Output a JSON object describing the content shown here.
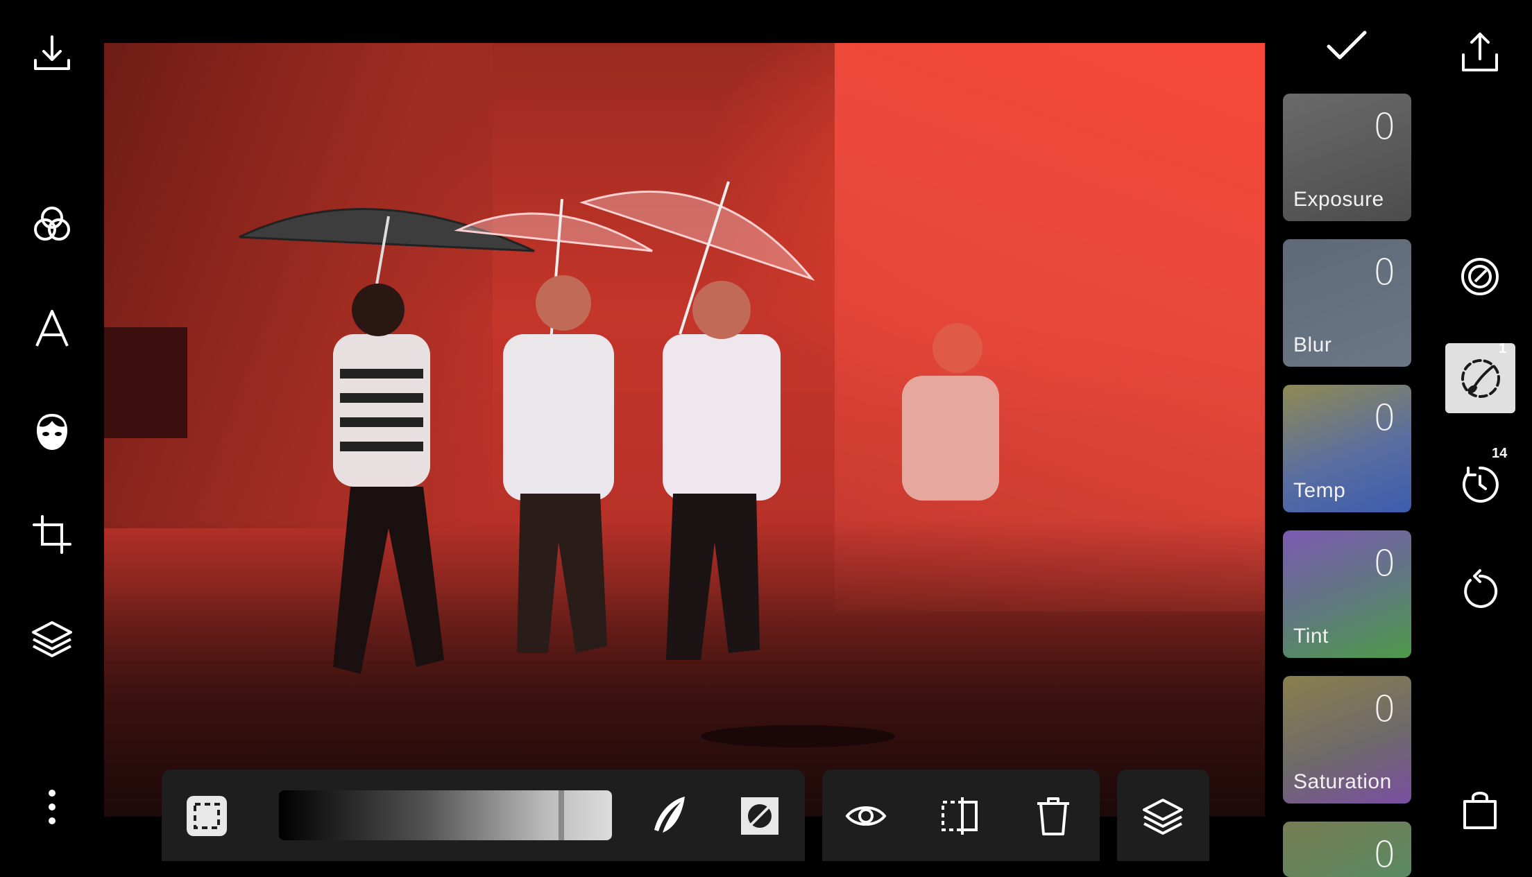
{
  "left_toolbar": {
    "icons": [
      "download-icon",
      "filters-icon",
      "text-icon",
      "face-icon",
      "crop-icon",
      "layers-icon",
      "more-icon"
    ]
  },
  "bottom_tools": {
    "icons": [
      "select-area-icon",
      "brush-icon",
      "invert-mask-icon",
      "eye-icon",
      "split-view-icon",
      "trash-icon",
      "layers-icon"
    ],
    "mask_gradient_level": 0.92
  },
  "adjustments": {
    "exposure": {
      "label": "Exposure",
      "value": "0"
    },
    "blur": {
      "label": "Blur",
      "value": "0"
    },
    "temp": {
      "label": "Temp",
      "value": "0"
    },
    "tint": {
      "label": "Tint",
      "value": "0"
    },
    "saturation": {
      "label": "Saturation",
      "value": "0"
    },
    "next": {
      "value": "0"
    }
  },
  "right_toolbar": {
    "confirm_icon": "checkmark-icon",
    "share_icon": "share-icon",
    "mask_badge": "1",
    "history_badge": "14",
    "bag_icon": "shopping-bag-icon"
  },
  "colors": {
    "background": "#000000",
    "panel": "#1e1e1e",
    "overlay_red": "#f04432",
    "active_tool_bg": "#e0e0e0"
  }
}
